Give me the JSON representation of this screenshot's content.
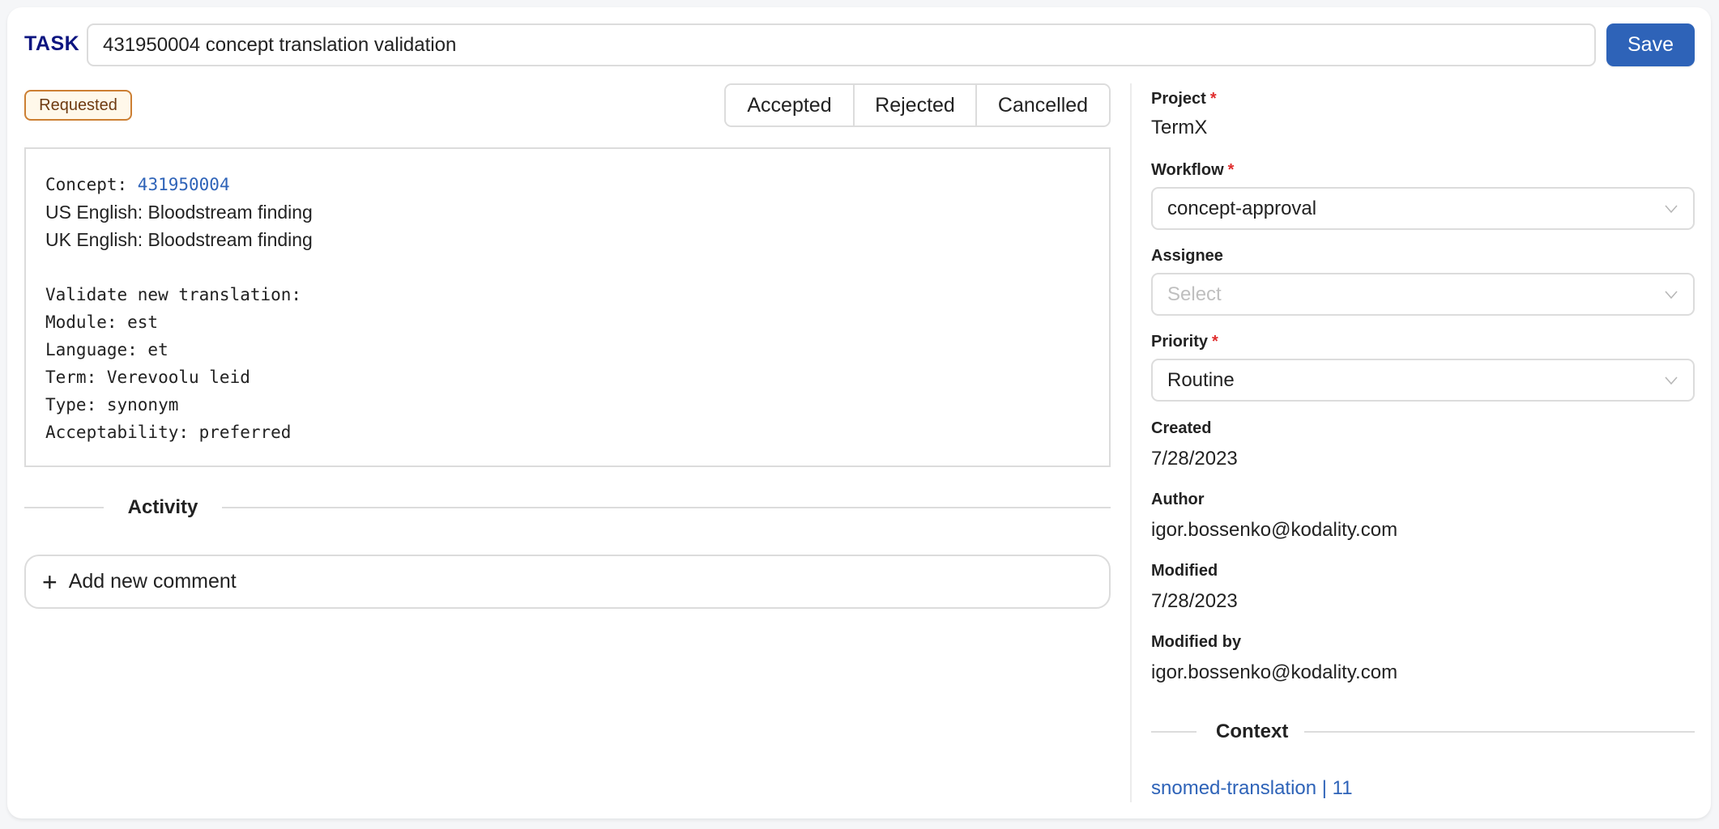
{
  "header": {
    "task_label": "TASK",
    "title_value": "431950004 concept translation validation",
    "save_label": "Save"
  },
  "status": {
    "badge": "Requested",
    "badge_colors": {
      "border": "#cc7f33",
      "background": "#fff8ea",
      "text": "#6e3b11"
    },
    "actions": [
      "Accepted",
      "Rejected",
      "Cancelled"
    ]
  },
  "content": {
    "concept_label": "Concept: ",
    "concept_code": "431950004",
    "us_english": "US English: Bloodstream finding",
    "uk_english": "UK English: Bloodstream finding",
    "details": [
      "Validate new translation:",
      "Module: est",
      "Language: et",
      "Term: Verevoolu leid",
      "Type: synonym",
      "Acceptability: preferred"
    ]
  },
  "activity": {
    "title": "Activity",
    "add_comment_label": "Add new comment"
  },
  "sidebar": {
    "project": {
      "label": "Project",
      "value": "TermX",
      "required": true
    },
    "workflow": {
      "label": "Workflow",
      "value": "concept-approval",
      "required": true
    },
    "assignee": {
      "label": "Assignee",
      "placeholder": "Select",
      "required": false
    },
    "priority": {
      "label": "Priority",
      "value": "Routine",
      "required": true
    },
    "created": {
      "label": "Created",
      "value": "7/28/2023"
    },
    "author": {
      "label": "Author",
      "value": "igor.bossenko@kodality.com"
    },
    "modified": {
      "label": "Modified",
      "value": "7/28/2023"
    },
    "modified_by": {
      "label": "Modified by",
      "value": "igor.bossenko@kodality.com"
    },
    "context": {
      "title": "Context",
      "link": "snomed-translation | 11"
    },
    "required_marker": "*"
  },
  "colors": {
    "accent": "#2e63b8",
    "task_label": "#0d1580",
    "required": "#e02d2d"
  }
}
